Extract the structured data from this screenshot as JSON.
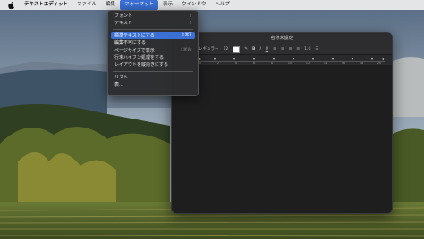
{
  "menubar": {
    "app_name": "テキストエディット",
    "items": [
      "ファイル",
      "編集",
      "フォーマット",
      "表示",
      "ウインドウ",
      "ヘルプ"
    ]
  },
  "format_menu": {
    "font": "フォント",
    "text": "テキスト",
    "make_plain_text": "標準テキストにする",
    "make_plain_text_shortcut": "⇧⌘T",
    "prevent_editing": "編集不可にする",
    "wrap_to_page": "ページサイズで表示",
    "wrap_to_page_shortcut": "⇧⌘W",
    "allow_hyphenation": "行末ハイフン処理をする",
    "make_layout_vertical": "レイアウトを縦向きにする",
    "list": "リスト...",
    "table": "表..."
  },
  "window": {
    "title": "名称未設定",
    "font_label": "レギュラー",
    "font_size": "12",
    "bold": "B",
    "italic": "I",
    "underline": "U",
    "spacing": "1.0",
    "ruler_ticks": [
      "0",
      "2",
      "4",
      "6",
      "8",
      "10",
      "12",
      "14",
      "16",
      "18",
      "20"
    ]
  },
  "colors": {
    "menu_highlight": "#3a6fd6",
    "window_bg": "#1f1f20",
    "menubar_bg": "#ebebee"
  }
}
